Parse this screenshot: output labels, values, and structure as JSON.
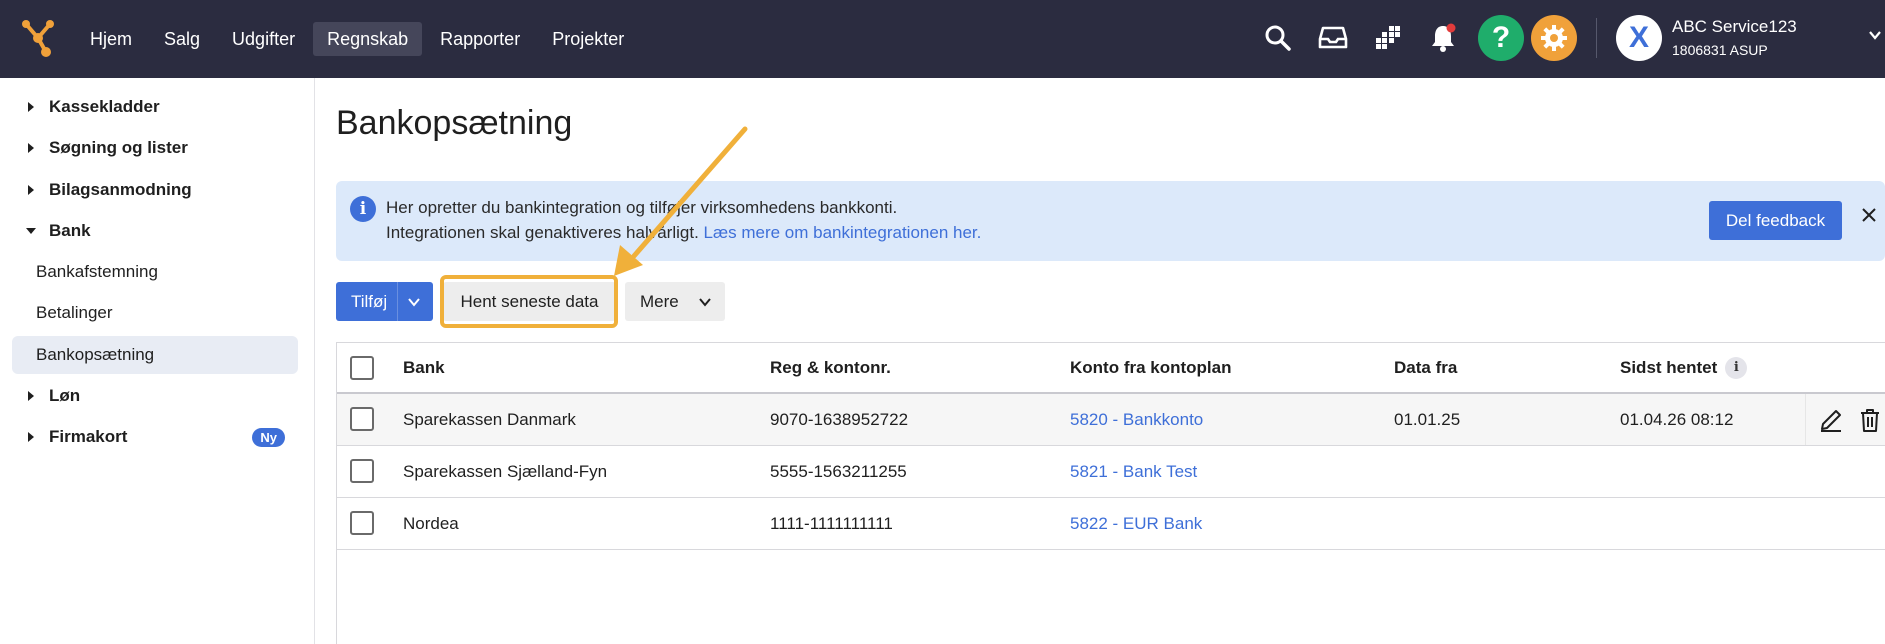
{
  "topbar": {
    "nav": [
      "Hjem",
      "Salg",
      "Udgifter",
      "Regnskab",
      "Rapporter",
      "Projekter"
    ],
    "active_nav": "Regnskab",
    "help_label": "?",
    "avatar_letter": "X",
    "company_name": "ABC Service123",
    "company_sub": "1806831 ASUP",
    "colors": {
      "bar": "#2b2c40",
      "help": "#1fad6b",
      "settings": "#f0a13a"
    }
  },
  "sidebar": {
    "items": [
      {
        "label": "Kassekladder",
        "type": "parent",
        "expanded": false
      },
      {
        "label": "Søgning og lister",
        "type": "parent",
        "expanded": false
      },
      {
        "label": "Bilagsanmodning",
        "type": "parent",
        "expanded": false
      },
      {
        "label": "Bank",
        "type": "parent",
        "expanded": true
      },
      {
        "label": "Bankafstemning",
        "type": "child"
      },
      {
        "label": "Betalinger",
        "type": "child"
      },
      {
        "label": "Bankopsætning",
        "type": "child",
        "selected": true
      },
      {
        "label": "Løn",
        "type": "parent",
        "expanded": false
      },
      {
        "label": "Firmakort",
        "type": "parent",
        "expanded": false,
        "badge": "Ny"
      }
    ]
  },
  "main": {
    "title": "Bankopsætning",
    "info": {
      "line1": "Her opretter du bankintegration og tilføjer virksomhedens bankkonti.",
      "line2": "Integrationen skal genaktiveres halvårligt.",
      "link": "Læs mere om bankintegrationen her.",
      "feedback_button": "Del feedback"
    },
    "toolbar": {
      "add_label": "Tilføj",
      "fetch_label": "Hent seneste data",
      "more_label": "Mere"
    },
    "table": {
      "headers": {
        "bank": "Bank",
        "reg": "Reg & kontonr.",
        "konto": "Konto fra kontoplan",
        "from": "Data fra",
        "last": "Sidst hentet"
      },
      "rows": [
        {
          "bank": "Sparekassen Danmark",
          "reg": "9070-1638952722",
          "konto": "5820 - Bankkonto",
          "from": "01.01.25",
          "last": "01.04.26 08:12"
        },
        {
          "bank": "Sparekassen Sjælland-Fyn",
          "reg": "5555-1563211255",
          "konto": "5821 - Bank Test",
          "from": "",
          "last": ""
        },
        {
          "bank": "Nordea",
          "reg": "1111-1111111111",
          "konto": "5822 - EUR Bank",
          "from": "",
          "last": ""
        }
      ]
    }
  },
  "annotation": {
    "arrow_color": "#f0b03a",
    "highlight_color": "#f0b03a"
  }
}
